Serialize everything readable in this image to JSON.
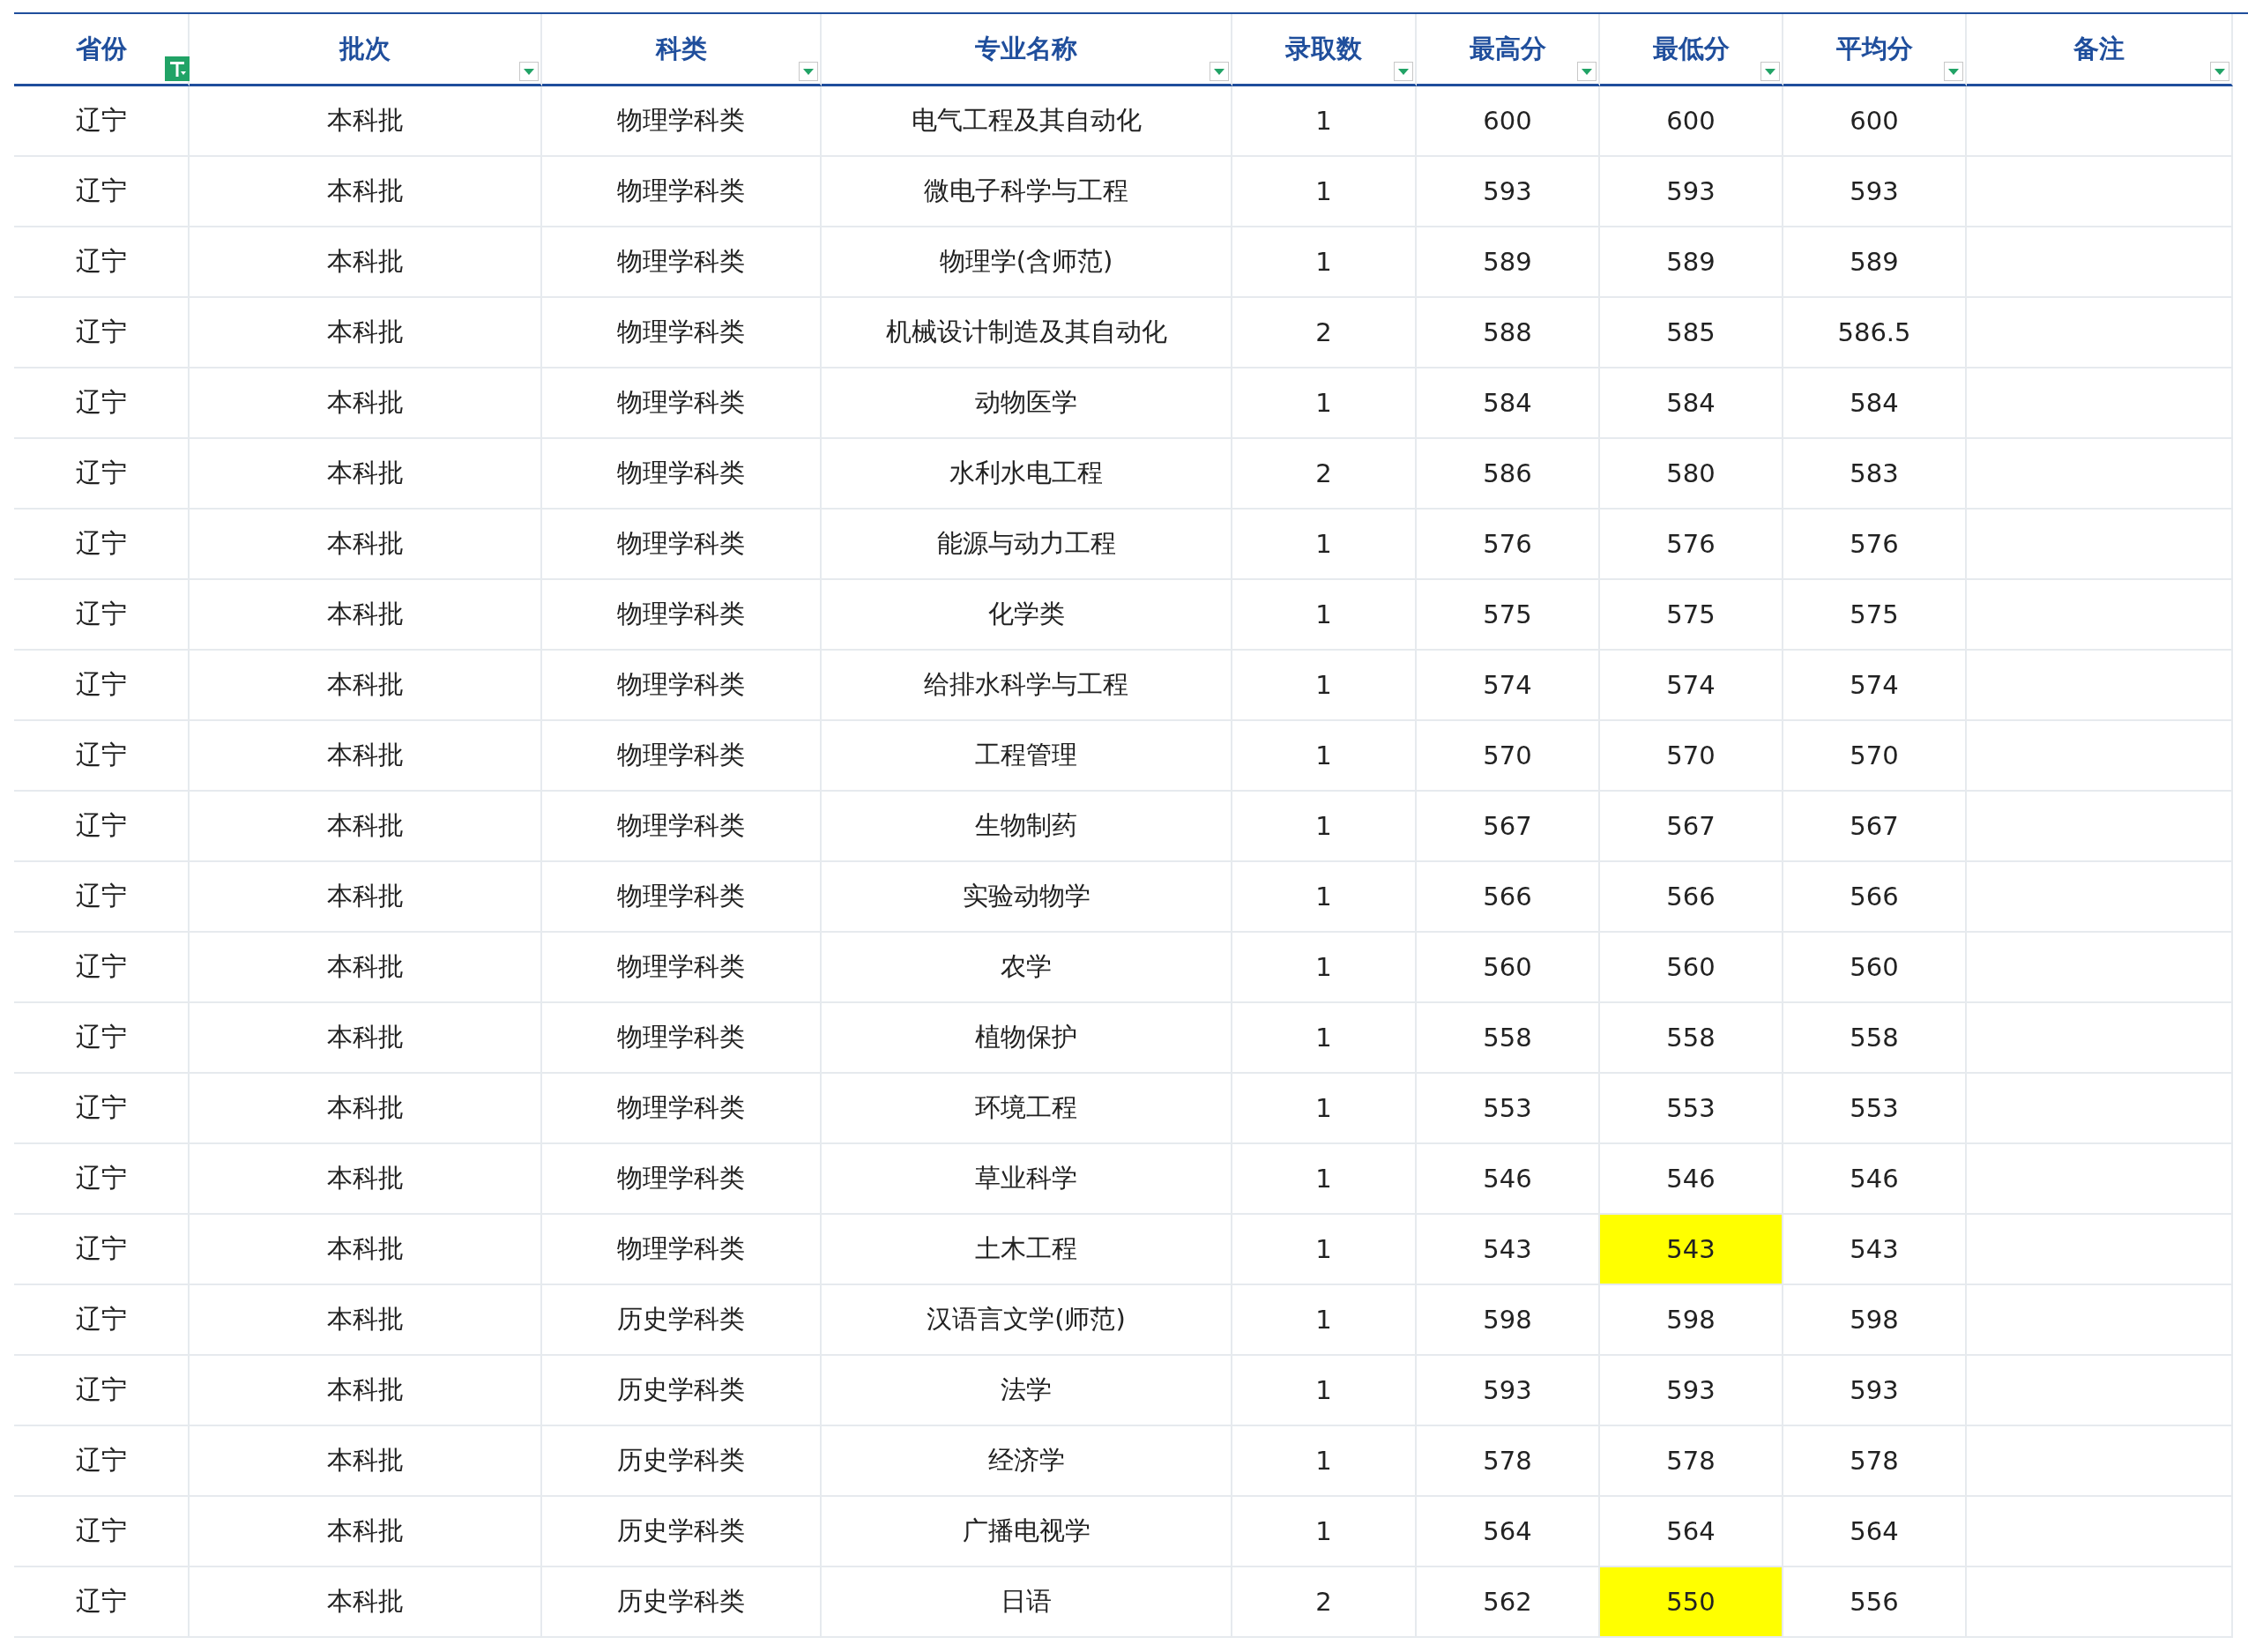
{
  "table": {
    "columns": [
      {
        "label": "省份",
        "filter_active": true
      },
      {
        "label": "批次",
        "filter_active": false
      },
      {
        "label": "科类",
        "filter_active": false
      },
      {
        "label": "专业名称",
        "filter_active": false
      },
      {
        "label": "录取数",
        "filter_active": false
      },
      {
        "label": "最高分",
        "filter_active": false
      },
      {
        "label": "最低分",
        "filter_active": false
      },
      {
        "label": "平均分",
        "filter_active": false
      },
      {
        "label": "备注",
        "filter_active": false
      }
    ],
    "rows": [
      {
        "cells": [
          "辽宁",
          "本科批",
          "物理学科类",
          "电气工程及其自动化",
          "1",
          "600",
          "600",
          "600"
        ],
        "min_highlighted": false
      },
      {
        "cells": [
          "辽宁",
          "本科批",
          "物理学科类",
          "微电子科学与工程",
          "1",
          "593",
          "593",
          "593"
        ],
        "min_highlighted": false
      },
      {
        "cells": [
          "辽宁",
          "本科批",
          "物理学科类",
          "物理学(含师范)",
          "1",
          "589",
          "589",
          "589"
        ],
        "min_highlighted": false
      },
      {
        "cells": [
          "辽宁",
          "本科批",
          "物理学科类",
          "机械设计制造及其自动化",
          "2",
          "588",
          "585",
          "586.5"
        ],
        "min_highlighted": false
      },
      {
        "cells": [
          "辽宁",
          "本科批",
          "物理学科类",
          "动物医学",
          "1",
          "584",
          "584",
          "584"
        ],
        "min_highlighted": false
      },
      {
        "cells": [
          "辽宁",
          "本科批",
          "物理学科类",
          "水利水电工程",
          "2",
          "586",
          "580",
          "583"
        ],
        "min_highlighted": false
      },
      {
        "cells": [
          "辽宁",
          "本科批",
          "物理学科类",
          "能源与动力工程",
          "1",
          "576",
          "576",
          "576"
        ],
        "min_highlighted": false
      },
      {
        "cells": [
          "辽宁",
          "本科批",
          "物理学科类",
          "化学类",
          "1",
          "575",
          "575",
          "575"
        ],
        "min_highlighted": false
      },
      {
        "cells": [
          "辽宁",
          "本科批",
          "物理学科类",
          "给排水科学与工程",
          "1",
          "574",
          "574",
          "574"
        ],
        "min_highlighted": false
      },
      {
        "cells": [
          "辽宁",
          "本科批",
          "物理学科类",
          "工程管理",
          "1",
          "570",
          "570",
          "570"
        ],
        "min_highlighted": false
      },
      {
        "cells": [
          "辽宁",
          "本科批",
          "物理学科类",
          "生物制药",
          "1",
          "567",
          "567",
          "567"
        ],
        "min_highlighted": false
      },
      {
        "cells": [
          "辽宁",
          "本科批",
          "物理学科类",
          "实验动物学",
          "1",
          "566",
          "566",
          "566"
        ],
        "min_highlighted": false
      },
      {
        "cells": [
          "辽宁",
          "本科批",
          "物理学科类",
          "农学",
          "1",
          "560",
          "560",
          "560"
        ],
        "min_highlighted": false
      },
      {
        "cells": [
          "辽宁",
          "本科批",
          "物理学科类",
          "植物保护",
          "1",
          "558",
          "558",
          "558"
        ],
        "min_highlighted": false
      },
      {
        "cells": [
          "辽宁",
          "本科批",
          "物理学科类",
          "环境工程",
          "1",
          "553",
          "553",
          "553"
        ],
        "min_highlighted": false
      },
      {
        "cells": [
          "辽宁",
          "本科批",
          "物理学科类",
          "草业科学",
          "1",
          "546",
          "546",
          "546"
        ],
        "min_highlighted": false
      },
      {
        "cells": [
          "辽宁",
          "本科批",
          "物理学科类",
          "土木工程",
          "1",
          "543",
          "543",
          "543"
        ],
        "min_highlighted": true
      },
      {
        "cells": [
          "辽宁",
          "本科批",
          "历史学科类",
          "汉语言文学(师范)",
          "1",
          "598",
          "598",
          "598"
        ],
        "min_highlighted": false
      },
      {
        "cells": [
          "辽宁",
          "本科批",
          "历史学科类",
          "法学",
          "1",
          "593",
          "593",
          "593"
        ],
        "min_highlighted": false
      },
      {
        "cells": [
          "辽宁",
          "本科批",
          "历史学科类",
          "经济学",
          "1",
          "578",
          "578",
          "578"
        ],
        "min_highlighted": false
      },
      {
        "cells": [
          "辽宁",
          "本科批",
          "历史学科类",
          "广播电视学",
          "1",
          "564",
          "564",
          "564"
        ],
        "min_highlighted": false
      },
      {
        "cells": [
          "辽宁",
          "本科批",
          "历史学科类",
          "日语",
          "2",
          "562",
          "550",
          "556"
        ],
        "min_highlighted": true
      }
    ]
  }
}
